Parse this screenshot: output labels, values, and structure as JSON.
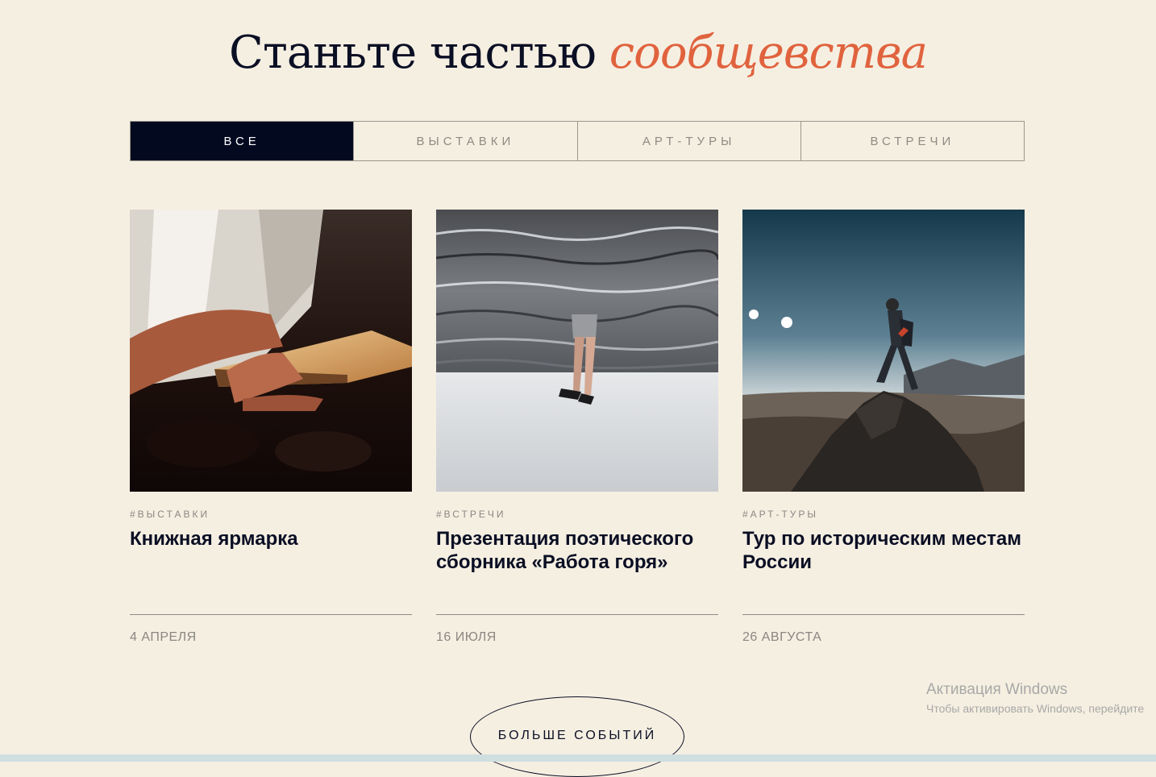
{
  "header": {
    "title_plain": "Станьте частью",
    "title_accent": "сообщевства"
  },
  "filters": {
    "tabs": [
      {
        "label": "ВСЕ",
        "active": true
      },
      {
        "label": "ВЫСТАВКИ",
        "active": false
      },
      {
        "label": "АРТ-ТУРЫ",
        "active": false
      },
      {
        "label": "ВСТРЕЧИ",
        "active": false
      }
    ]
  },
  "events": [
    {
      "tag": "#ВЫСТАВКИ",
      "title": "Книжная ярмарка",
      "date": "4 АПРЕЛЯ",
      "image": "hands-holding-book"
    },
    {
      "tag": "#ВСТРЕЧИ",
      "title": "Презентация поэтического сборника «Работа горя»",
      "date": "16 ИЮЛЯ",
      "image": "person-under-water-surface"
    },
    {
      "tag": "#АРТ-ТУРЫ",
      "title": "Тур по историческим местам России",
      "date": "26 АВГУСТА",
      "image": "hiker-on-mountain-rock"
    }
  ],
  "more_button": {
    "label": "БОЛЬШЕ СОБЫТИЙ"
  },
  "os_watermark": {
    "title": "Активация Windows",
    "subtitle": "Чтобы активировать Windows, перейдите"
  },
  "colors": {
    "background": "#f5efe2",
    "accent": "#e0633e",
    "dark": "#030a20",
    "muted_text": "#8a8782"
  }
}
